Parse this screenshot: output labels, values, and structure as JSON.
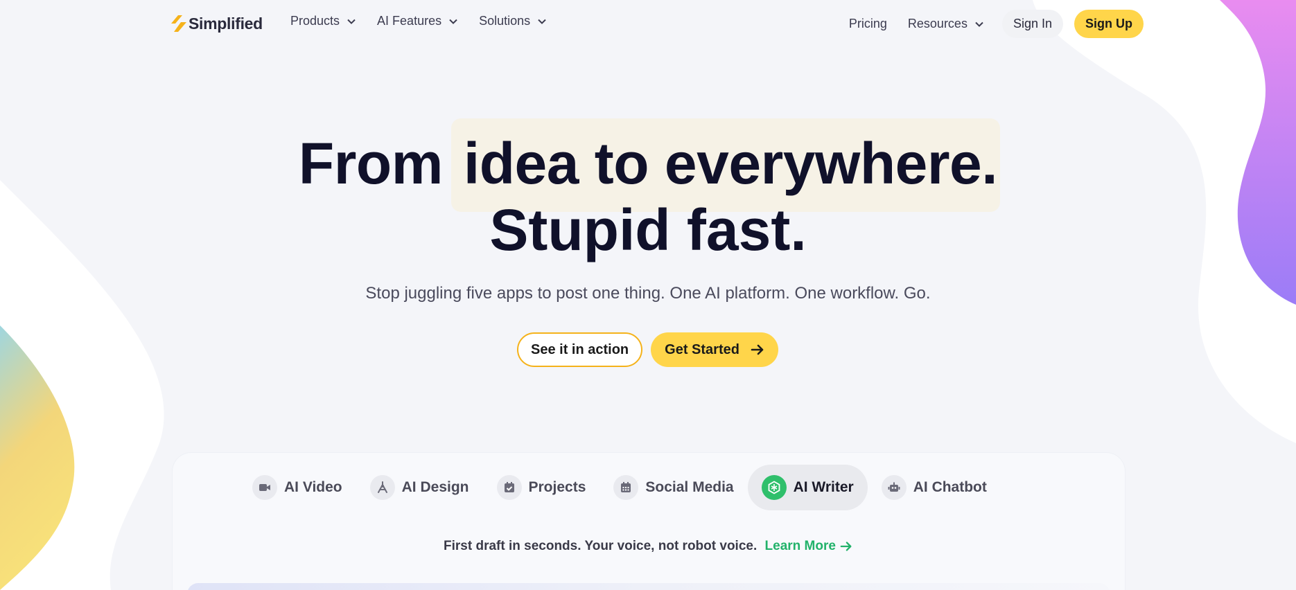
{
  "brand": {
    "name": "Simplified",
    "accent": "#ffd54a",
    "accent_border": "#f5b21a",
    "green": "#22b26a",
    "logo_icon": "lightning-logo-icon"
  },
  "nav": {
    "left": [
      {
        "label": "Products",
        "icon": "chevron-down-icon"
      },
      {
        "label": "AI Features",
        "icon": "chevron-down-icon"
      },
      {
        "label": "Solutions",
        "icon": "chevron-down-icon"
      }
    ],
    "pricing": "Pricing",
    "resources": "Resources",
    "sign_in": "Sign In",
    "sign_up": "Sign Up"
  },
  "hero": {
    "line1_a": "From",
    "line1_b": "idea to everywhere.",
    "line2": "Stupid fast.",
    "subtitle": "Stop juggling five apps to post one thing. One AI platform. One workflow. Go.",
    "cta_secondary": "See it in action",
    "cta_primary": "Get Started"
  },
  "tabs": [
    {
      "label": "AI Video",
      "icon": "video-camera-icon",
      "active": false
    },
    {
      "label": "AI Design",
      "icon": "pen-tool-icon",
      "active": false
    },
    {
      "label": "Projects",
      "icon": "calendar-check-icon",
      "active": false
    },
    {
      "label": "Social Media",
      "icon": "calendar-grid-icon",
      "active": false
    },
    {
      "label": "AI Writer",
      "icon": "ai-writer-logo-icon",
      "active": true
    },
    {
      "label": "AI Chatbot",
      "icon": "robot-icon",
      "active": false
    }
  ],
  "feature": {
    "tagline": "First draft in seconds. Your voice, not robot voice.",
    "learn_more": "Learn More"
  }
}
